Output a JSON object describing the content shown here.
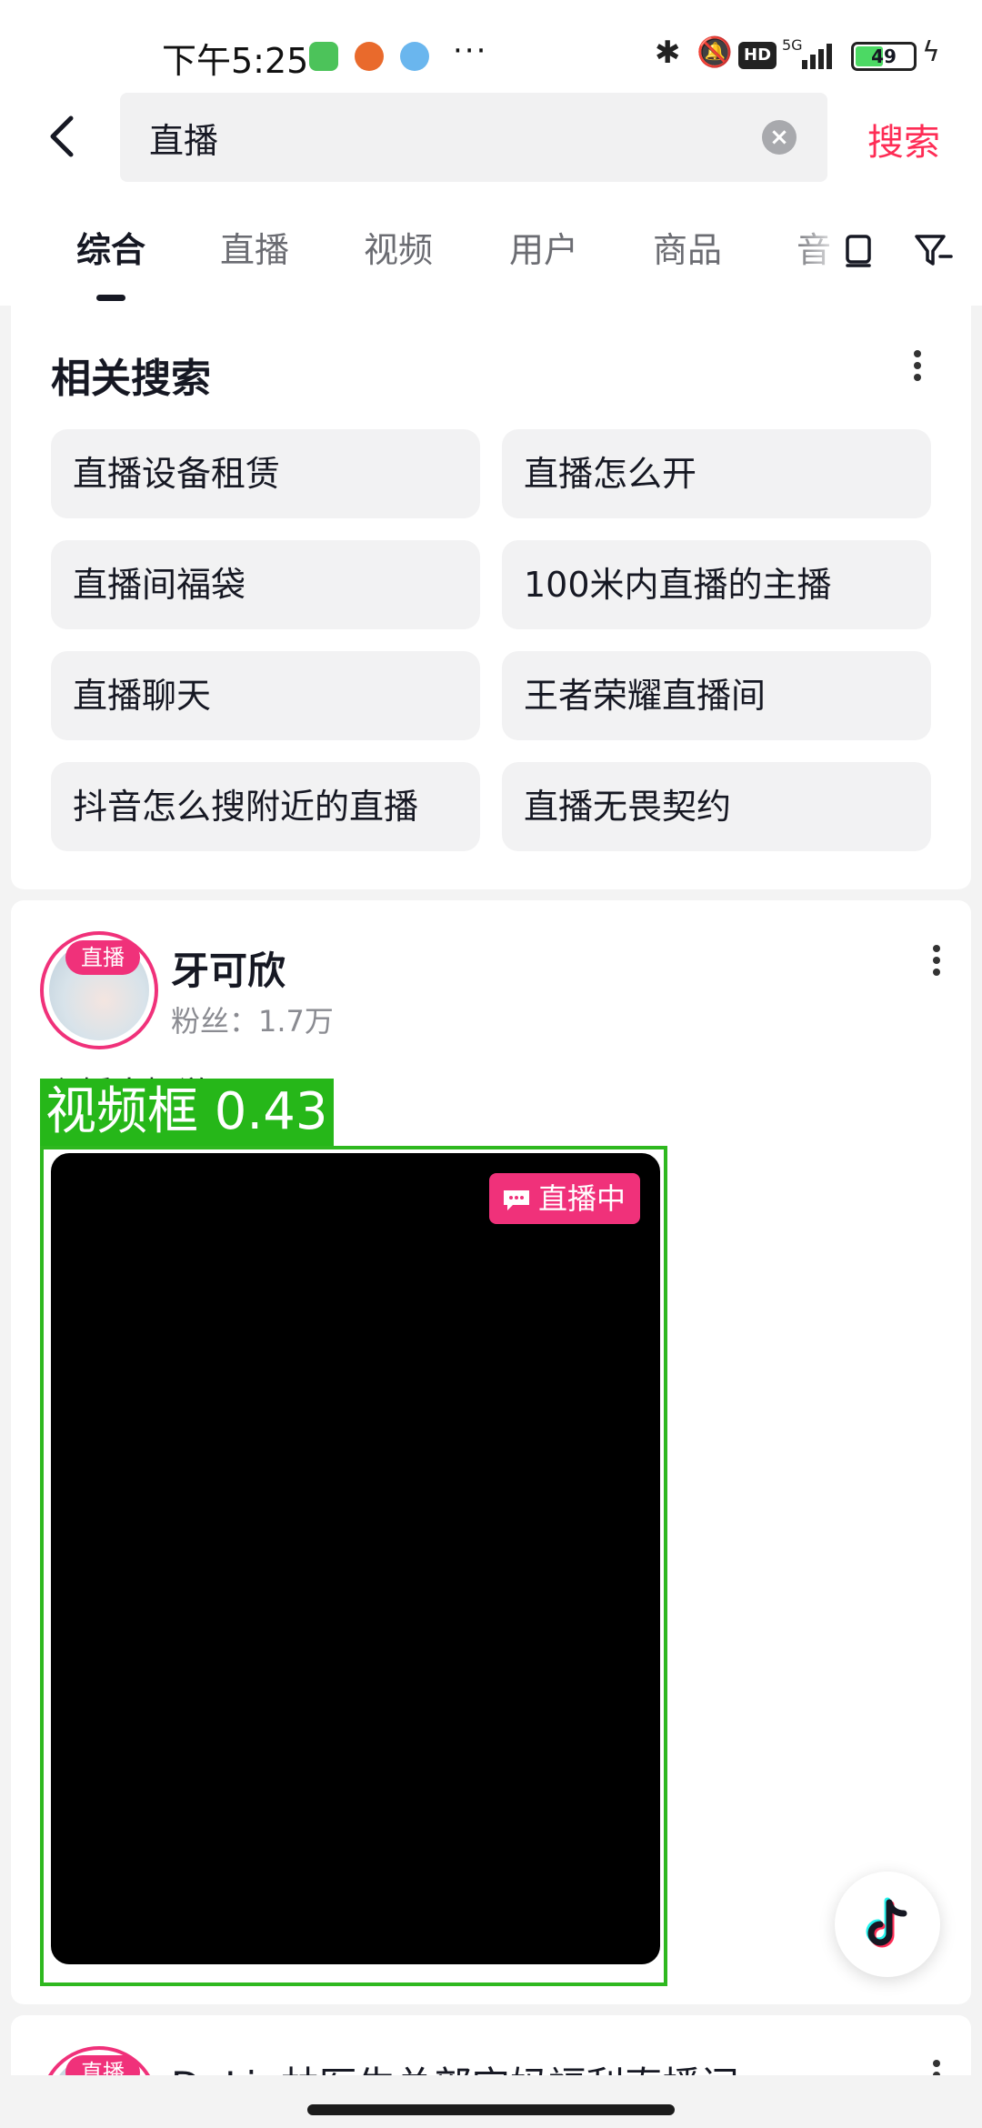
{
  "status_bar": {
    "time": "下午5:25",
    "more": "···",
    "hd": "HD",
    "network": "5G",
    "battery": "49",
    "icons": [
      "app-icon-green",
      "app-icon-58",
      "app-icon-cloud",
      "bluetooth-icon",
      "bell-off-icon",
      "signal-icon",
      "charging-icon"
    ]
  },
  "header": {
    "query": "直播",
    "search_label": "搜索"
  },
  "tabs": {
    "items": [
      "综合",
      "直播",
      "视频",
      "用户",
      "商品",
      "音"
    ],
    "active": "综合"
  },
  "related": {
    "title": "相关搜索",
    "items": [
      "直播设备租赁",
      "直播怎么开",
      "直播间福袋",
      "100米内直播的主播",
      "直播聊天",
      "王者荣耀直播间",
      "抖音怎么搜附近的直播",
      "直播无畏契约"
    ]
  },
  "post": {
    "avatar_badge": "直播",
    "user_name": "牙可欣",
    "fans": "粉丝：1.7万",
    "caption": "主播大概游",
    "live_badge": "直播中",
    "detection_label": "视频框 0.43"
  },
  "next_post": {
    "avatar_badge": "直播",
    "user_name": "Dr.Lin林医生总部宝妈福利直播间"
  },
  "colors": {
    "accent": "#fe2c55",
    "live_pink": "#f0317a",
    "detection_green": "#2eb81f"
  }
}
